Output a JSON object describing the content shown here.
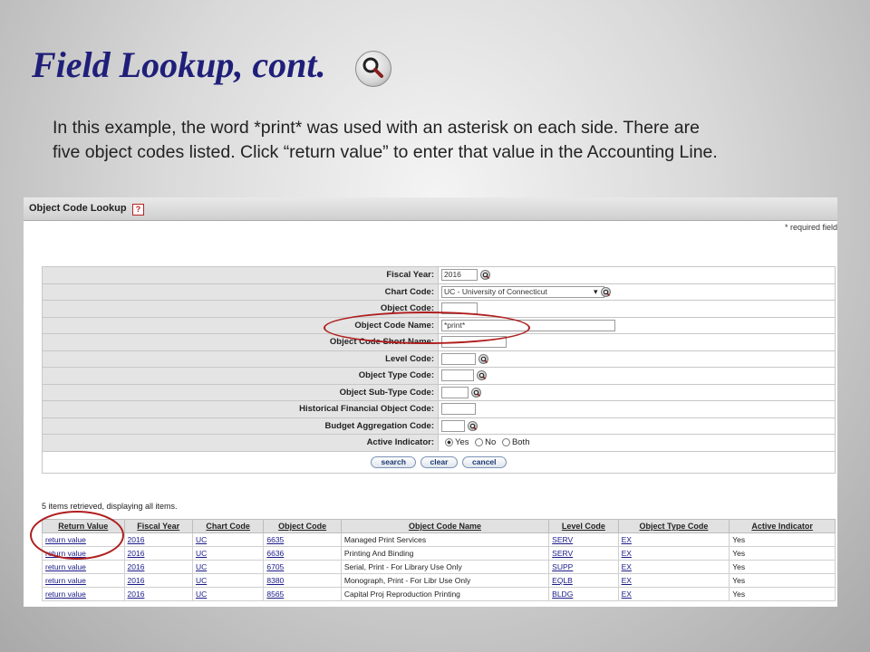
{
  "slide": {
    "title": "Field Lookup, cont.",
    "body": "In this example, the word *print* was used with an asterisk on each side.  There are five object codes listed. Click “return value” to enter that value in the Accounting Line."
  },
  "screen": {
    "title": "Object Code Lookup",
    "help_label": "?",
    "required_note": "* required field",
    "criteria": [
      {
        "label": "Fiscal Year:",
        "value": "2016",
        "lookup": true
      },
      {
        "label": "Chart Code:",
        "value": "UC - University of Connecticut",
        "lookup": true,
        "select": true
      },
      {
        "label": "Object Code:",
        "value": "",
        "lookup": false
      },
      {
        "label": "Object Code Name:",
        "value": "*print*",
        "lookup": false
      },
      {
        "label": "Object Code Short Name:",
        "value": "",
        "lookup": false
      },
      {
        "label": "Level Code:",
        "value": "",
        "lookup": true
      },
      {
        "label": "Object Type Code:",
        "value": "",
        "lookup": true
      },
      {
        "label": "Object Sub-Type Code:",
        "value": "",
        "lookup": true
      },
      {
        "label": "Historical Financial Object Code:",
        "value": "",
        "lookup": false
      },
      {
        "label": "Budget Aggregation Code:",
        "value": "",
        "lookup": true
      }
    ],
    "active_indicator": {
      "label": "Active Indicator:",
      "options": [
        "Yes",
        "No",
        "Both"
      ],
      "selected": "Yes"
    },
    "buttons": {
      "search": "search",
      "clear": "clear",
      "cancel": "cancel"
    },
    "result_count": "5 items retrieved, displaying all items.",
    "results": {
      "columns": [
        "Return Value",
        "Fiscal Year",
        "Chart Code",
        "Object Code",
        "Object Code Name",
        "Level Code",
        "Object Type Code",
        "Active Indicator"
      ],
      "rows": [
        [
          "return value",
          "2016",
          "UC",
          "6635",
          "Managed Print Services",
          "SERV",
          "EX",
          "Yes"
        ],
        [
          "return value",
          "2016",
          "UC",
          "6636",
          "Printing And Binding",
          "SERV",
          "EX",
          "Yes"
        ],
        [
          "return value",
          "2016",
          "UC",
          "6705",
          "Serial, Print - For Library Use Only",
          "SUPP",
          "EX",
          "Yes"
        ],
        [
          "return value",
          "2016",
          "UC",
          "8380",
          "Monograph, Print - For Libr Use Only",
          "EQLB",
          "EX",
          "Yes"
        ],
        [
          "return value",
          "2016",
          "UC",
          "8565",
          "Capital Proj Reproduction Printing",
          "BLDG",
          "EX",
          "Yes"
        ]
      ]
    }
  },
  "colors": {
    "title": "#1f1f7a",
    "annotation": "#b01e1e",
    "link": "#1a1a8a"
  }
}
